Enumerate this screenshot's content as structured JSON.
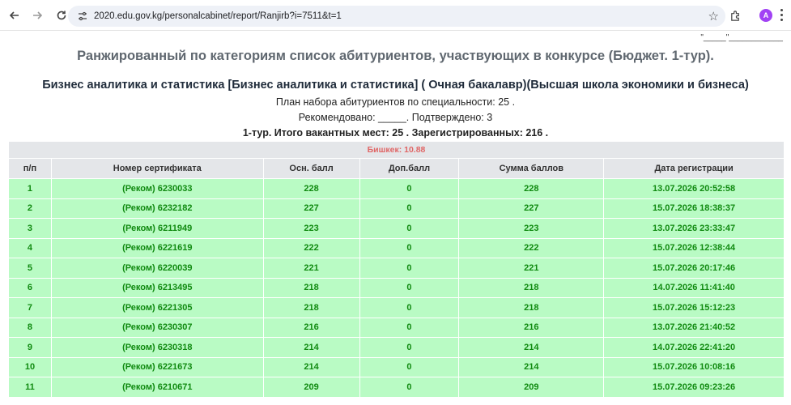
{
  "browser": {
    "url": "2020.edu.gov.kg/personalcabinet/report/Ranjirb?i=7511&t=1",
    "profile_initial": "A",
    "colors": {
      "avatar": "#a142f4"
    }
  },
  "header": {
    "signature_line": "\"_____\"____________",
    "main_title": "Ранжированный по категориям список абитуриентов, участвующих в конкурсе (Бюджет. 1-тур).",
    "specialty_title": "Бизнес аналитика и статистика [Бизнес аналитика и статистика] ( Очная бакалавр)(Высшая школа экономики и бизнеса)",
    "plan_text": "План набора абитуриентов по специальности: 25 .",
    "recommended_text": "Рекомендовано: _____. Подтверждено: 3",
    "tour_summary": "1-тур. Итого вакантных мест: 25 . Зарегистрированных: 216 ."
  },
  "table": {
    "region_label": "Бишкек: 10.88",
    "columns": [
      "п/п",
      "Номер сертификата",
      "Осн. балл",
      "Доп.балл",
      "Сумма баллов",
      "Дата регистрации"
    ],
    "rows": [
      [
        "1",
        "(Реком) 6230033",
        "228",
        "0",
        "228",
        "13.07.2026 20:52:58"
      ],
      [
        "2",
        "(Реком) 6232182",
        "227",
        "0",
        "227",
        "15.07.2026 18:38:37"
      ],
      [
        "3",
        "(Реком) 6211949",
        "223",
        "0",
        "223",
        "13.07.2026 23:33:47"
      ],
      [
        "4",
        "(Реком) 6221619",
        "222",
        "0",
        "222",
        "15.07.2026 12:38:44"
      ],
      [
        "5",
        "(Реком) 6220039",
        "221",
        "0",
        "221",
        "15.07.2026 20:17:46"
      ],
      [
        "6",
        "(Реком) 6213495",
        "218",
        "0",
        "218",
        "14.07.2026 11:41:40"
      ],
      [
        "7",
        "(Реком) 6221305",
        "218",
        "0",
        "218",
        "15.07.2026 15:12:23"
      ],
      [
        "8",
        "(Реком) 6230307",
        "216",
        "0",
        "216",
        "13.07.2026 21:40:52"
      ],
      [
        "9",
        "(Реком) 6230318",
        "214",
        "0",
        "214",
        "14.07.2026 22:41:20"
      ],
      [
        "10",
        "(Реком) 6221673",
        "214",
        "0",
        "214",
        "15.07.2026 10:08:16"
      ],
      [
        "11",
        "(Реком) 6210671",
        "209",
        "0",
        "209",
        "15.07.2026 09:23:26"
      ]
    ],
    "colors": {
      "row_bg": "#b9fbc4",
      "row_text": "#108a10",
      "region_text": "#e06666",
      "header_bg": "#e4e6e9"
    }
  }
}
